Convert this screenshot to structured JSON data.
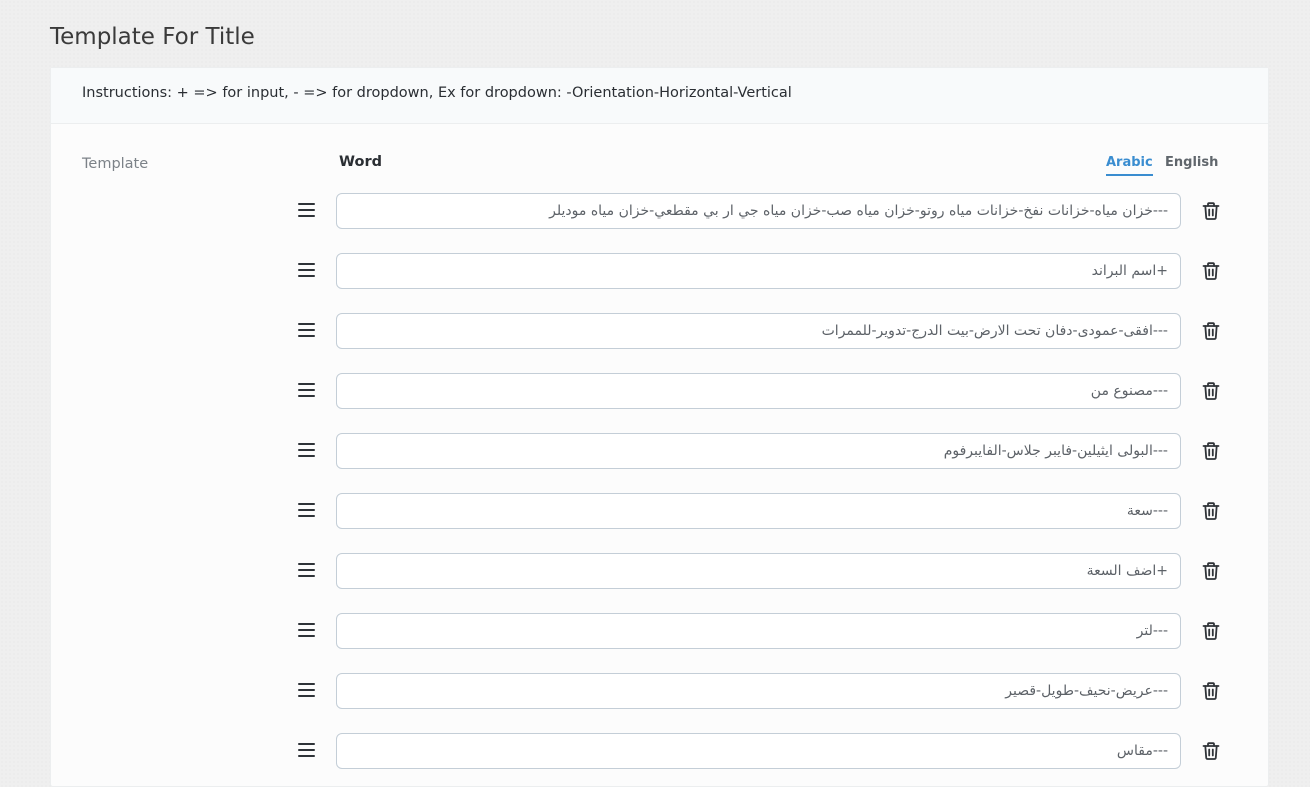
{
  "page": {
    "title": "Template For Title"
  },
  "card": {
    "instructions": "Instructions: + => for input, - => for dropdown, Ex for dropdown: -Orientation-Horizontal-Vertical",
    "field_label": "Template",
    "column_header": "Word",
    "language_tabs": [
      {
        "label": "Arabic",
        "active": true
      },
      {
        "label": "English",
        "active": false
      }
    ]
  },
  "rows": [
    {
      "value": "---خزان مياه-خزانات نفخ-خزانات مياه روتو-خزان مياه صب-خزان مياه جي ار بي مقطعي-خزان مياه موديلر"
    },
    {
      "value": "+اسم البراند"
    },
    {
      "value": "---افقى-عمودى-دفان تحت الارض-بيت الدرج-تدوير-للممرات"
    },
    {
      "value": "---مصنوع من"
    },
    {
      "value": "---البولى ايثيلين-فايبر جلاس-الفايبرفوم"
    },
    {
      "value": "---سعة"
    },
    {
      "value": "+اضف السعة"
    },
    {
      "value": "---لتر"
    },
    {
      "value": "---عريض-نحيف-طويل-قصير"
    },
    {
      "value": "---مقاس"
    }
  ],
  "colors": {
    "accent": "#3a8dd0",
    "input_border": "#c4ced7",
    "text": "#2a2e33"
  },
  "icons": {
    "drag": "hamburger-drag-icon",
    "delete": "trash-icon"
  }
}
